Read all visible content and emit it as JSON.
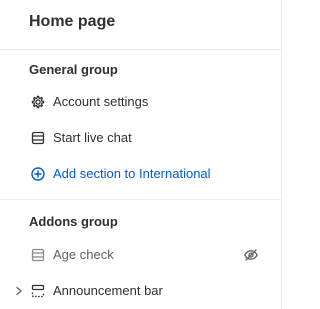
{
  "header": {
    "title": "Home page"
  },
  "general_group": {
    "heading": "General group",
    "items": [
      {
        "label": "Account settings",
        "icon": "gear-icon"
      },
      {
        "label": "Start live chat",
        "icon": "section-icon"
      }
    ],
    "add_section_label": "Add section to International"
  },
  "addons_group": {
    "heading": "Addons group",
    "items": [
      {
        "label": "Age check",
        "icon": "section-icon",
        "hidden": true,
        "trailing_icon": "eye-off-icon"
      },
      {
        "label": "Announcement bar",
        "icon": "header-section-icon",
        "expandable": true
      }
    ]
  },
  "colors": {
    "text": "#303030",
    "muted_text": "#616161",
    "accent": "#005bd3",
    "divider": "#ebebeb"
  }
}
